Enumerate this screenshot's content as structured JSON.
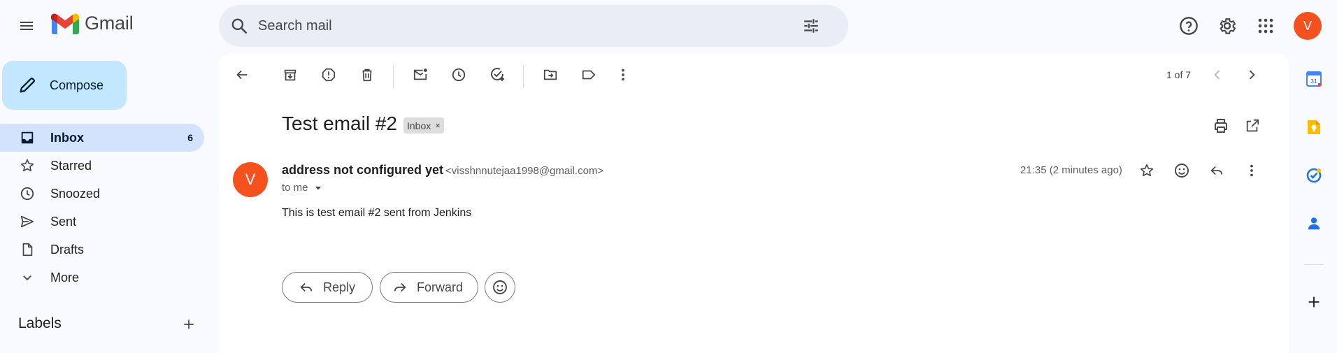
{
  "app": {
    "name": "Gmail"
  },
  "header": {
    "search": {
      "placeholder": "Search mail"
    },
    "avatar_letter": "V"
  },
  "sidebar": {
    "compose_label": "Compose",
    "items": [
      {
        "label": "Inbox",
        "count": "6",
        "icon": "inbox-icon",
        "active": true
      },
      {
        "label": "Starred",
        "count": "",
        "icon": "star-icon"
      },
      {
        "label": "Snoozed",
        "count": "",
        "icon": "clock-icon"
      },
      {
        "label": "Sent",
        "count": "",
        "icon": "send-icon"
      },
      {
        "label": "Drafts",
        "count": "",
        "icon": "draft-icon"
      },
      {
        "label": "More",
        "count": "",
        "icon": "chevron-down-icon"
      }
    ],
    "labels_title": "Labels"
  },
  "toolbar": {
    "pager_text": "1 of 7"
  },
  "email": {
    "subject": "Test email #2",
    "label_chip": "Inbox",
    "chip_remove": "×",
    "sender_initial": "V",
    "sender_name": "address not configured yet",
    "sender_email": "<visshnnutejaa1998@gmail.com>",
    "to": "to me",
    "date": "21:35 (2 minutes ago)",
    "body": "This is test email #2 sent from Jenkins"
  },
  "actions": {
    "reply_label": "Reply",
    "forward_label": "Forward"
  },
  "rail": {
    "calendar_day": "31"
  },
  "colors": {
    "accent_red": "#f4511e",
    "compose_bg": "#c2e7ff",
    "active_nav_bg": "#d3e3fd",
    "search_bg": "#e9eef6",
    "page_bg": "#f8fafd"
  }
}
